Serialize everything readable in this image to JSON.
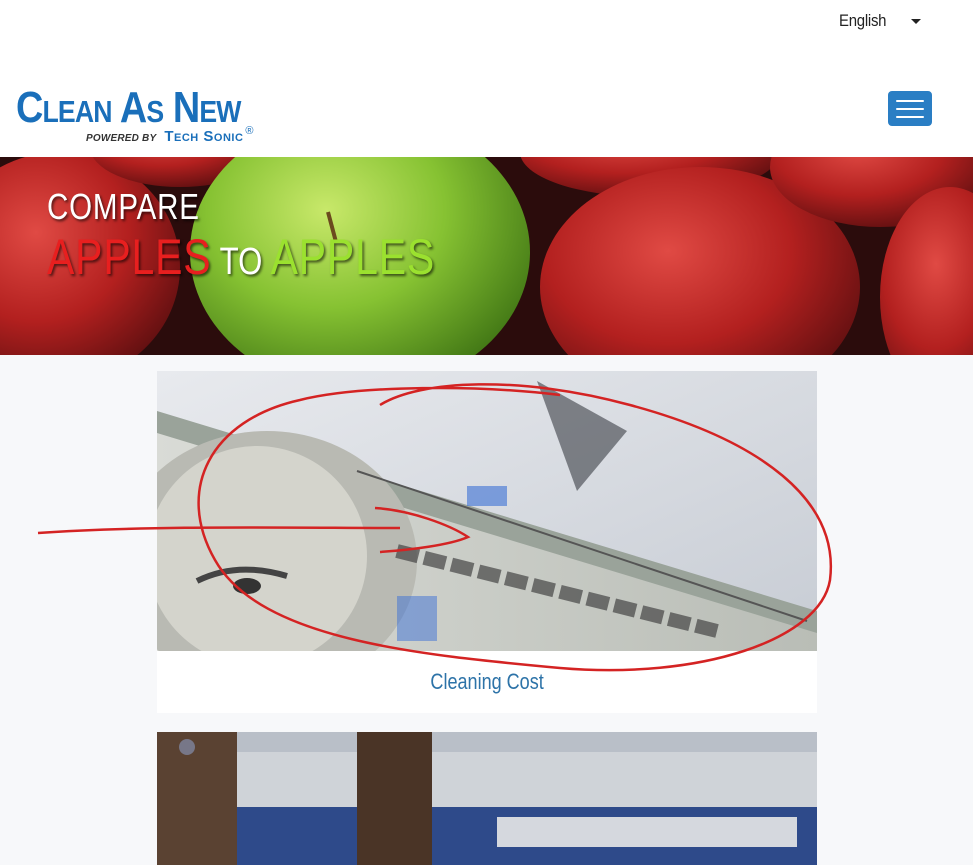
{
  "topbar": {
    "language_label": "English"
  },
  "header": {
    "logo_main": "Clean As New",
    "logo_powered": "POWERED BY",
    "logo_tech": "Tech Sonic",
    "logo_reg": "®"
  },
  "hero": {
    "line1": "COMPARE",
    "word_red": "APPLES",
    "word_to": "TO",
    "word_green": "APPLES"
  },
  "cards": [
    {
      "caption": "Cleaning Cost"
    }
  ],
  "colors": {
    "brand_blue": "#1a6fba",
    "menu_button": "#2a7ec4",
    "apple_red_text": "#e81f1f",
    "apple_green_text": "#9be12f",
    "link": "#2d73a8",
    "annotation": "#d42323"
  }
}
